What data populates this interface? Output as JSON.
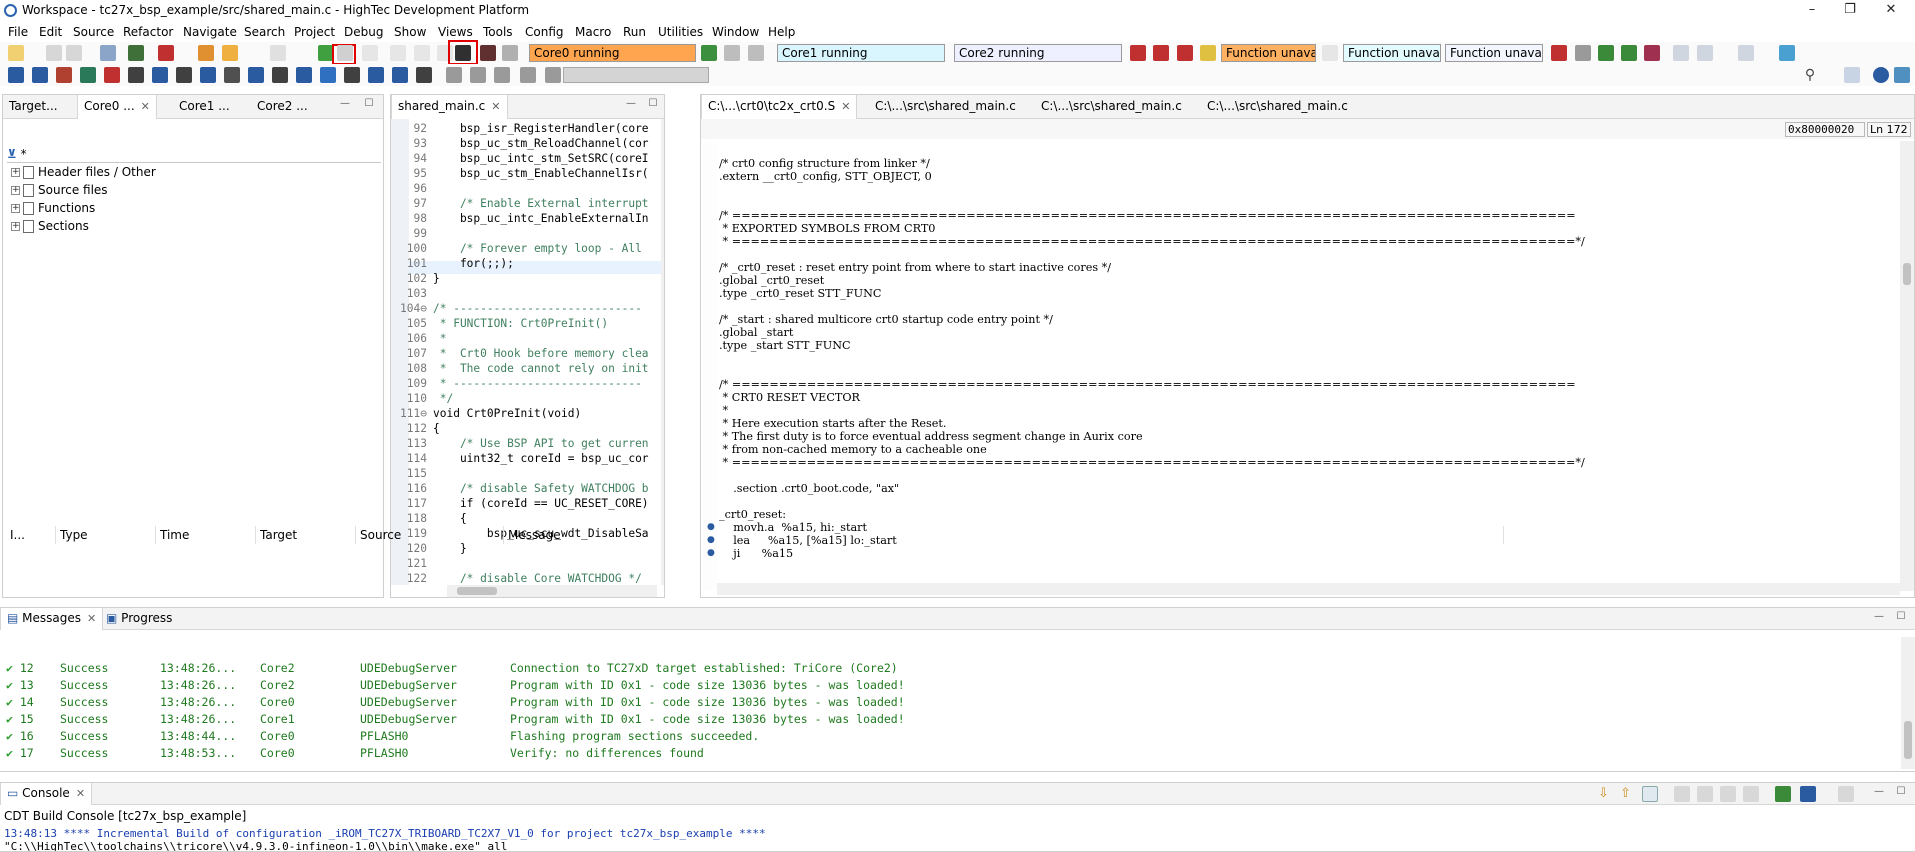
{
  "window": {
    "title": "Workspace - tc27x_bsp_example/src/shared_main.c - HighTec Development Platform",
    "minimize": "–",
    "restore": "❐",
    "close": "✕"
  },
  "menu": [
    "File",
    "Edit",
    "Source",
    "Refactor",
    "Navigate",
    "Search",
    "Project",
    "Debug",
    "Show",
    "Views",
    "Tools",
    "Config",
    "Macro",
    "Run",
    "Utilities",
    "Window",
    "Help"
  ],
  "toolbar": {
    "core0_status": "Core0 running",
    "core1_status": "Core1 running",
    "core2_status": "Core2 running",
    "func_unavail_1": "Function unavai",
    "func_unavail_2": "Function unavai",
    "func_unavail_3": "Function unavai",
    "colors": {
      "core0": "#ffa54f",
      "core1": "#d9f6ff",
      "core2": "#eef0ff",
      "func1": "#ffb060",
      "func2": "#e2fbff",
      "func3": "#f4f6ff"
    }
  },
  "left_panel": {
    "tabs": [
      "Target...",
      "Core0 ...",
      "Core1 ...",
      "Core2 ..."
    ],
    "filter": "*",
    "tree": [
      "Header files / Other",
      "Source files",
      "Functions",
      "Sections"
    ]
  },
  "editor_left": {
    "tab": "shared_main.c",
    "lines": [
      {
        "n": "92",
        "t": "    bsp_isr_RegisterHandler(core"
      },
      {
        "n": "93",
        "t": "    bsp_uc_stm_ReloadChannel(cor"
      },
      {
        "n": "94",
        "t": "    bsp_uc_intc_stm_SetSRC(coreI"
      },
      {
        "n": "95",
        "t": "    bsp_uc_stm_EnableChannelIsr("
      },
      {
        "n": "96",
        "t": ""
      },
      {
        "n": "97",
        "t": "    /* Enable External interrupt"
      },
      {
        "n": "98",
        "t": "    bsp_uc_intc_EnableExternalIn"
      },
      {
        "n": "99",
        "t": ""
      },
      {
        "n": "100",
        "t": "    /* Forever empty loop - All"
      },
      {
        "n": "101",
        "t": "    for(;;);"
      },
      {
        "n": "102",
        "t": "}"
      },
      {
        "n": "103",
        "t": ""
      },
      {
        "n": "104⊖",
        "t": "/* ----------------------------"
      },
      {
        "n": "105",
        "t": " * FUNCTION: Crt0PreInit()"
      },
      {
        "n": "106",
        "t": " *"
      },
      {
        "n": "107",
        "t": " *  Crt0 Hook before memory clea"
      },
      {
        "n": "108",
        "t": " *  The code cannot rely on init"
      },
      {
        "n": "109",
        "t": " * ----------------------------"
      },
      {
        "n": "110",
        "t": " */"
      },
      {
        "n": "111⊖",
        "t": "void Crt0PreInit(void)"
      },
      {
        "n": "112",
        "t": "{"
      },
      {
        "n": "113",
        "t": "    /* Use BSP API to get curren"
      },
      {
        "n": "114",
        "t": "    uint32_t coreId = bsp_uc_cor"
      },
      {
        "n": "115",
        "t": ""
      },
      {
        "n": "116",
        "t": "    /* disable Safety WATCHDOG b"
      },
      {
        "n": "117",
        "t": "    if (coreId == UC_RESET_CORE)"
      },
      {
        "n": "118",
        "t": "    {"
      },
      {
        "n": "119",
        "t": "        bsp_uc_scu_wdt_DisableSa"
      },
      {
        "n": "120",
        "t": "    }"
      },
      {
        "n": "121",
        "t": ""
      },
      {
        "n": "122",
        "t": "    /* disable Core WATCHDOG */"
      }
    ]
  },
  "editor_right": {
    "tabs": [
      "C:\\...\\crt0\\tc2x_crt0.S",
      "C:\\...\\src\\shared_main.c",
      "C:\\...\\src\\shared_main.c",
      "C:\\...\\src\\shared_main.c"
    ],
    "address": "0x80000020",
    "line_info": "Ln 172",
    "lines": [
      "/* crt0 config structure from linker */",
      ".extern __crt0_config, STT_OBJECT, 0",
      "",
      "",
      "/* ==========================================================================================",
      " * EXPORTED SYMBOLS FROM CRT0",
      " * ==========================================================================================*/",
      "",
      "/* _crt0_reset : reset entry point from where to start inactive cores */",
      ".global _crt0_reset",
      ".type _crt0_reset STT_FUNC",
      "",
      "/* _start : shared multicore crt0 startup code entry point */",
      ".global _start",
      ".type _start STT_FUNC",
      "",
      "",
      "/* ==========================================================================================",
      " * CRT0 RESET VECTOR",
      " *",
      " * Here execution starts after the Reset.",
      " * The first duty is to force eventual address segment change in Aurix core",
      " * from non-cached memory to a cacheable one",
      " * ==========================================================================================*/",
      "",
      "    .section .crt0_boot.code, \"ax\"",
      "",
      "_crt0_reset:",
      "    movh.a  %a15, hi:_start",
      "    lea     %a15, [%a15] lo:_start",
      "    ji      %a15"
    ]
  },
  "messages": {
    "tabs": [
      "Messages",
      "Progress"
    ],
    "columns": [
      "I...",
      "Type",
      "Time",
      "Target",
      "Source",
      "Message"
    ],
    "rows": [
      {
        "id": "12",
        "type": "Success",
        "time": "13:48:26...",
        "target": "Core2",
        "source": "UDEDebugServer",
        "message": "Connection to TC27xD target established: TriCore (Core2)"
      },
      {
        "id": "13",
        "type": "Success",
        "time": "13:48:26...",
        "target": "Core2",
        "source": "UDEDebugServer",
        "message": "Program with ID 0x1 - code size 13036 bytes - was loaded!"
      },
      {
        "id": "14",
        "type": "Success",
        "time": "13:48:26...",
        "target": "Core0",
        "source": "UDEDebugServer",
        "message": "Program with ID 0x1 - code size 13036 bytes - was loaded!"
      },
      {
        "id": "15",
        "type": "Success",
        "time": "13:48:26...",
        "target": "Core1",
        "source": "UDEDebugServer",
        "message": "Program with ID 0x1 - code size 13036 bytes - was loaded!"
      },
      {
        "id": "16",
        "type": "Success",
        "time": "13:48:44...",
        "target": "Core0",
        "source": "PFLASH0",
        "message": "Flashing program sections succeeded."
      },
      {
        "id": "17",
        "type": "Success",
        "time": "13:48:53...",
        "target": "Core0",
        "source": "PFLASH0",
        "message": "Verify: no differences found"
      }
    ]
  },
  "console": {
    "tab": "Console",
    "header": "CDT Build Console [tc27x_bsp_example]",
    "line1": "13:48:13 **** Incremental Build of configuration _iROM_TC27X_TRIBOARD_TC2X7_V1_0 for project tc27x_bsp_example ****",
    "line2": "\"C:\\\\HighTec\\\\toolchains\\\\tricore\\\\v4.9.3.0-infineon-1.0\\\\bin\\\\make.exe\" all"
  }
}
